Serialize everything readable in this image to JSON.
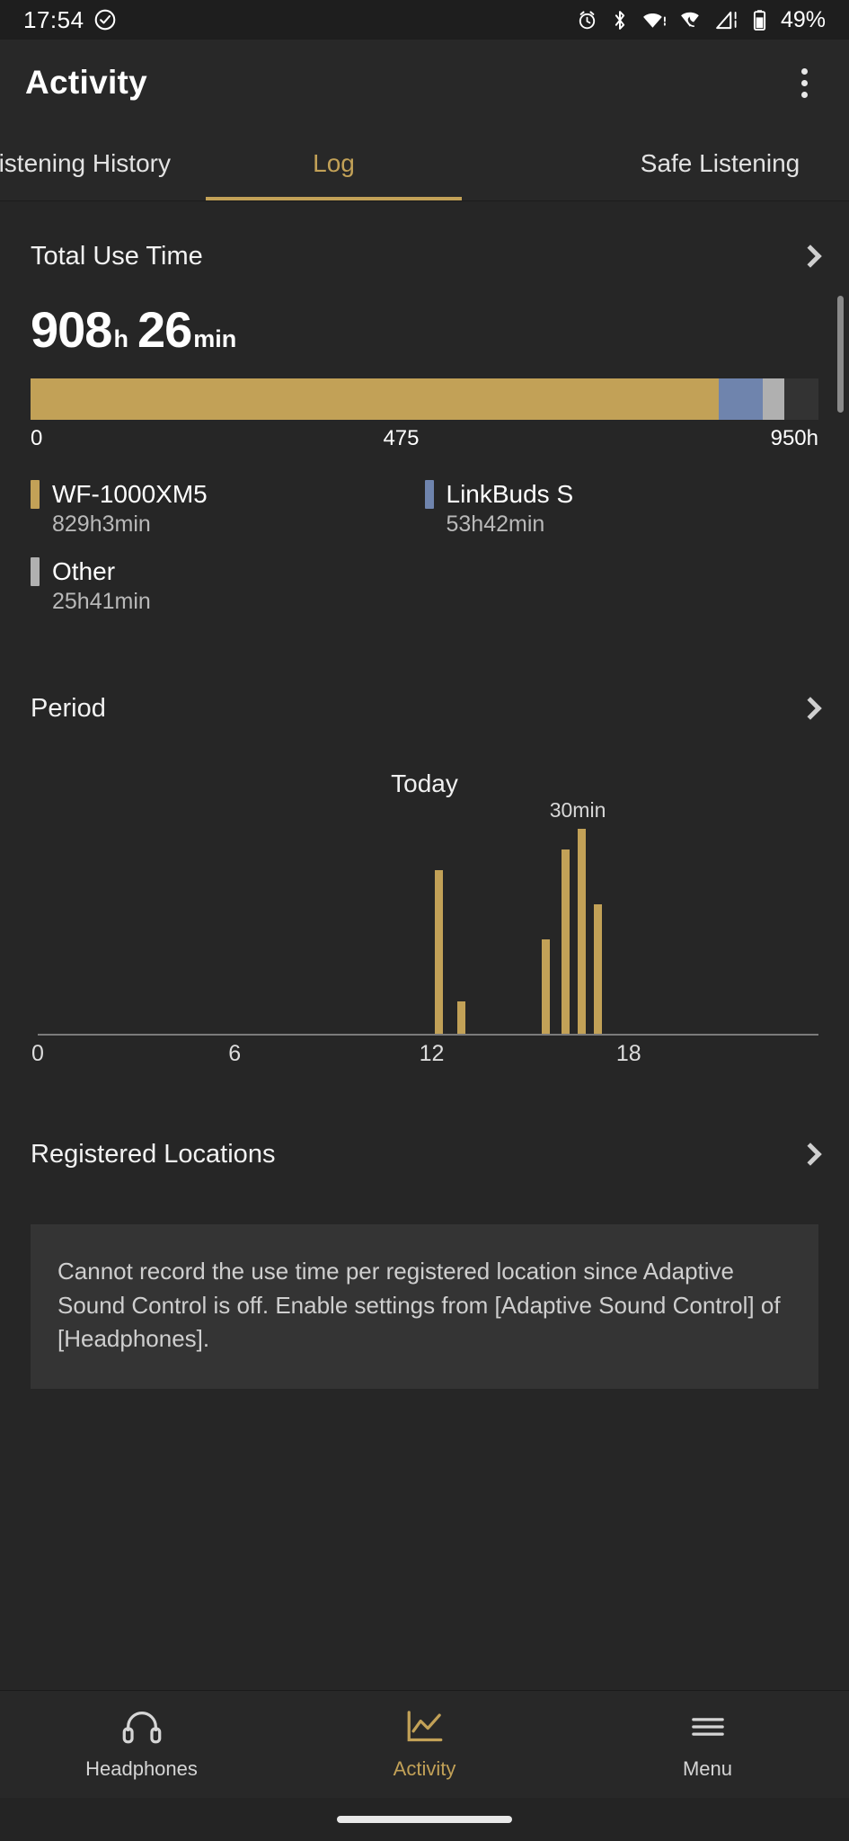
{
  "status_bar": {
    "time": "17:54",
    "battery_percent": "49%",
    "icons": [
      "check-circle-icon",
      "alarm-icon",
      "bluetooth-icon",
      "wifi-icon",
      "call-signal-icon",
      "cellular-signal-icon",
      "battery-icon"
    ]
  },
  "app_bar": {
    "title": "Activity",
    "overflow_menu": "overflow-menu"
  },
  "tabs": {
    "items": [
      {
        "label": "Listening History",
        "active": false
      },
      {
        "label": "Log",
        "active": true
      },
      {
        "label": "Safe Listening",
        "active": false
      }
    ],
    "active_color": "#c2a157"
  },
  "total_use_time": {
    "section_label": "Total Use Time",
    "hours": "908",
    "hours_unit": "h",
    "minutes": "26",
    "minutes_unit": "min",
    "scale": {
      "min": "0",
      "mid": "475",
      "max": "950h"
    },
    "devices": [
      {
        "name": "WF-1000XM5",
        "value": "829h3min",
        "color": "#c2a157"
      },
      {
        "name": "LinkBuds S",
        "value": "53h42min",
        "color": "#6f84ad"
      },
      {
        "name": "Other",
        "value": "25h41min",
        "color": "#b0b0b0"
      }
    ]
  },
  "period": {
    "section_label": "Period"
  },
  "chart_data": {
    "type": "bar",
    "title": "Today",
    "xlabel": "",
    "ylabel": "",
    "xlim": [
      0,
      24
    ],
    "ylim": [
      0,
      30
    ],
    "xticks": [
      0,
      6,
      12,
      18
    ],
    "xtick_labels": [
      "0",
      "6",
      "12",
      "18"
    ],
    "grid": false,
    "peak_annotation": "30min",
    "peak_x": 16.6,
    "bar_color": "#c2a157",
    "unit": "min",
    "x": [
      12.2,
      12.9,
      15.5,
      16.1,
      16.6,
      17.1
    ],
    "values": [
      24,
      5,
      14,
      27,
      30,
      19
    ]
  },
  "registered_locations": {
    "section_label": "Registered Locations",
    "notice": "Cannot record the use time per registered location since Adaptive Sound Control is off. Enable settings from [Adaptive Sound Control] of [Headphones]."
  },
  "bottom_nav": {
    "items": [
      {
        "label": "Headphones",
        "icon": "headphones-icon",
        "active": false
      },
      {
        "label": "Activity",
        "icon": "activity-chart-icon",
        "active": true
      },
      {
        "label": "Menu",
        "icon": "hamburger-menu-icon",
        "active": false
      }
    ]
  }
}
